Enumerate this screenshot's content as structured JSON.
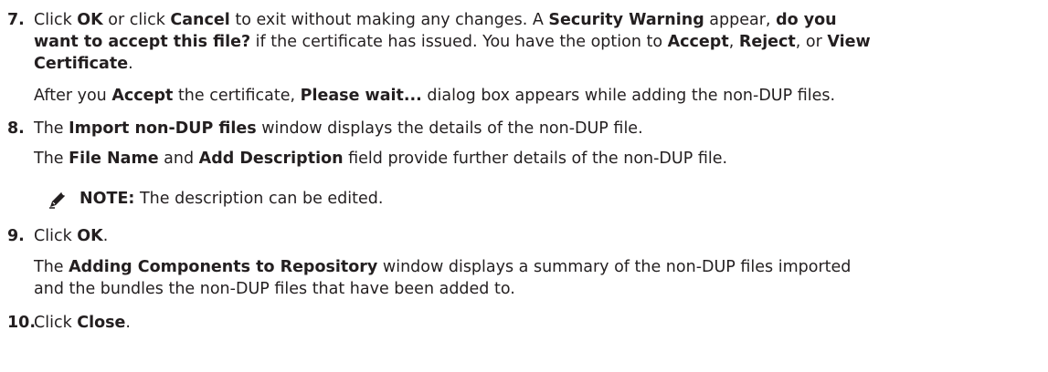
{
  "steps": [
    {
      "number": "7.",
      "lines": [
        [
          "Click ",
          "OK",
          " or click ",
          "Cancel",
          " to exit without making any changes. A ",
          "Security Warning",
          " appear, ",
          "do you"
        ],
        [
          "want to accept this file?",
          " if the certificate has issued. You have the option to ",
          "Accept",
          ", ",
          "Reject",
          ", or ",
          "View"
        ],
        [
          "Certificate",
          "."
        ]
      ],
      "follow": [
        "After you ",
        "Accept",
        " the certificate, ",
        "Please wait...",
        " dialog box appears while adding the non-DUP files."
      ]
    },
    {
      "number": "8.",
      "line1": [
        "The ",
        "Import non-DUP files",
        " window displays the details of the non-DUP file."
      ],
      "line2": [
        "The ",
        "File Name",
        " and ",
        "Add Description",
        " field provide further details of the non-DUP file."
      ],
      "note_label": "NOTE:",
      "note_text": " The description can be edited."
    },
    {
      "number": "9.",
      "line1": [
        "Click ",
        "OK",
        "."
      ],
      "follow1": [
        "The ",
        "Adding Components to Repository",
        " window displays a summary of the non-DUP files imported"
      ],
      "follow2": "and the bundles the non-DUP files that have been added to."
    },
    {
      "number": "10.",
      "line1": [
        "Click ",
        "Close",
        "."
      ]
    }
  ]
}
